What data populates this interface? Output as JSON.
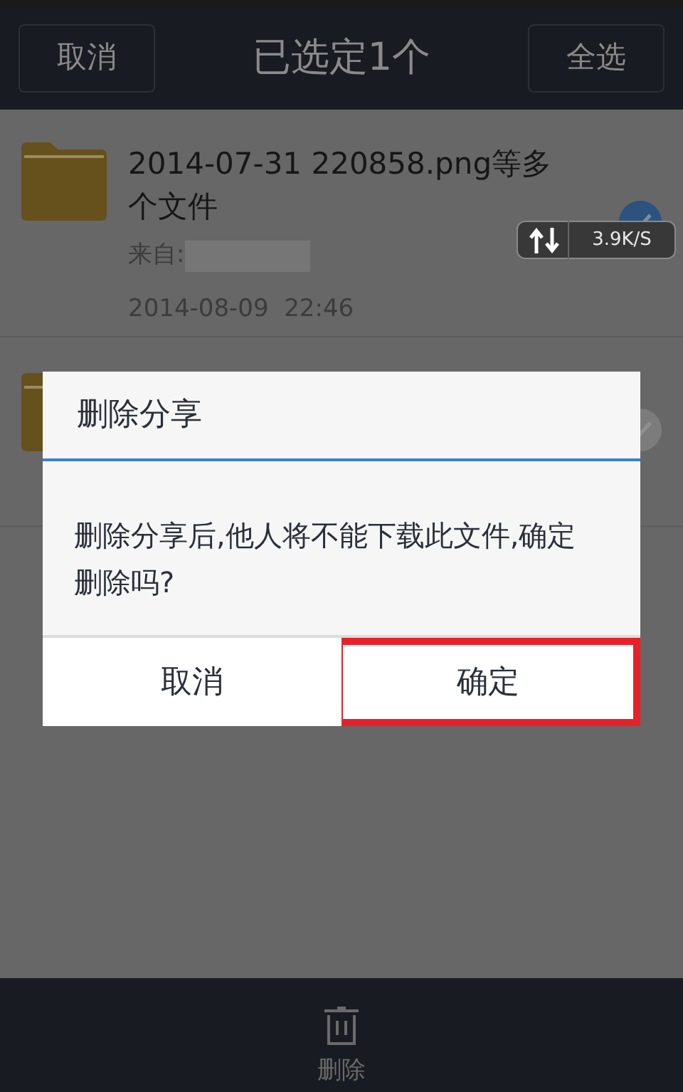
{
  "header": {
    "cancel": "取消",
    "title": "已选定1个",
    "select_all": "全选"
  },
  "files": [
    {
      "name": "2014-07-31 220858.png等多个文件",
      "source_label": "来自:",
      "date": "2014-08-09  22:46",
      "checked": true
    },
    {
      "checked": false
    }
  ],
  "speed_widget": {
    "speed": "3.9K/S"
  },
  "dialog": {
    "title": "删除分享",
    "message": "删除分享后,他人将不能下载此文件,确定删除吗?",
    "buttons": [
      {
        "label": "取消",
        "highlighted": false
      },
      {
        "label": "确定",
        "highlighted": true
      }
    ]
  },
  "bottom_bar": {
    "label": "删除"
  }
}
